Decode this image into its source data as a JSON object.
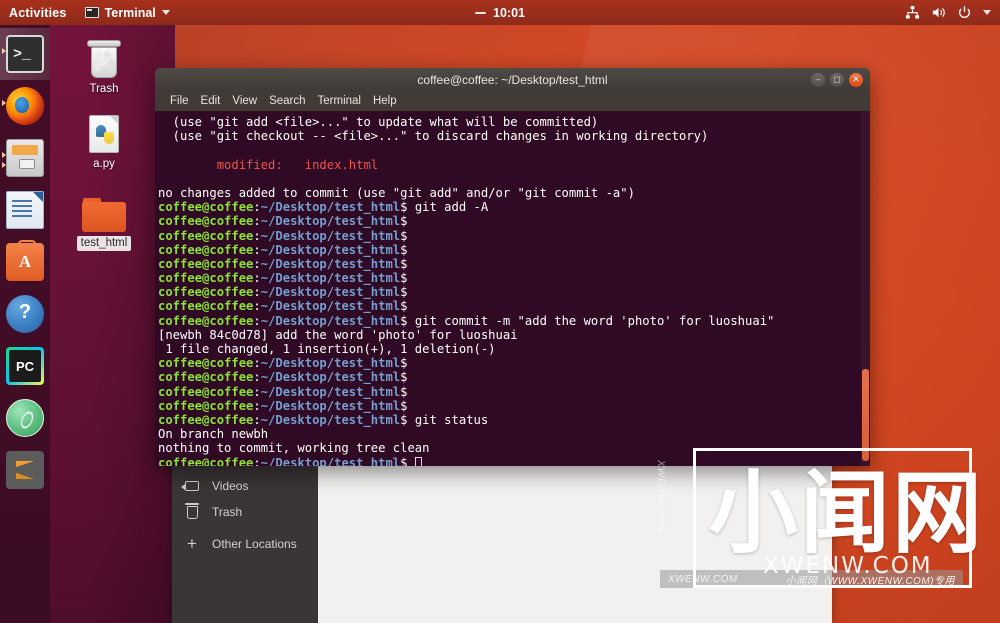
{
  "topbar": {
    "activities": "Activities",
    "app_name": "Terminal",
    "app_icon": "terminal-icon",
    "clock": "10:01",
    "indicators": [
      "network-icon",
      "volume-icon",
      "power-icon",
      "chevron-down-icon"
    ]
  },
  "launcher": {
    "items": [
      {
        "name": "terminal",
        "label": "Terminal",
        "active": true
      },
      {
        "name": "firefox",
        "label": "Firefox Web Browser",
        "active": false
      },
      {
        "name": "files",
        "label": "Files",
        "active": false
      },
      {
        "name": "libreoffice-writer",
        "label": "LibreOffice Writer",
        "active": false
      },
      {
        "name": "ubuntu-software",
        "label": "Ubuntu Software",
        "active": false
      },
      {
        "name": "help",
        "label": "Help",
        "active": false
      },
      {
        "name": "pycharm",
        "label": "PyCharm",
        "active": false
      },
      {
        "name": "atom",
        "label": "Atom",
        "active": false
      },
      {
        "name": "sublime-text",
        "label": "Sublime Text",
        "active": false
      }
    ]
  },
  "desktop": {
    "icons": [
      {
        "name": "trash",
        "label": "Trash",
        "selected": false
      },
      {
        "name": "a-py-file",
        "label": "a.py",
        "selected": false
      },
      {
        "name": "test-html-folder",
        "label": "test_html",
        "selected": true
      }
    ]
  },
  "file_manager": {
    "sidebar": [
      {
        "label": "Videos",
        "icon": "video-icon"
      },
      {
        "label": "Trash",
        "icon": "trash-icon"
      },
      {
        "label": "Other Locations",
        "icon": "plus-icon"
      }
    ]
  },
  "terminal": {
    "title": "coffee@coffee: ~/Desktop/test_html",
    "menu": [
      "File",
      "Edit",
      "View",
      "Search",
      "Terminal",
      "Help"
    ],
    "window_buttons": [
      "minimize",
      "maximize",
      "close"
    ],
    "prompt_user": "coffee@coffee",
    "prompt_path": "~/Desktop/test_html",
    "lines": [
      {
        "type": "plain",
        "text": "  (use \"git add <file>...\" to update what will be committed)"
      },
      {
        "type": "plain",
        "text": "  (use \"git checkout -- <file>...\" to discard changes in working directory)"
      },
      {
        "type": "plain",
        "text": ""
      },
      {
        "type": "red",
        "text": "        modified:   index.html"
      },
      {
        "type": "plain",
        "text": ""
      },
      {
        "type": "plain",
        "text": "no changes added to commit (use \"git add\" and/or \"git commit -a\")"
      },
      {
        "type": "prompt",
        "cmd": " git add -A"
      },
      {
        "type": "prompt",
        "cmd": ""
      },
      {
        "type": "prompt",
        "cmd": ""
      },
      {
        "type": "prompt",
        "cmd": ""
      },
      {
        "type": "prompt",
        "cmd": ""
      },
      {
        "type": "prompt",
        "cmd": ""
      },
      {
        "type": "prompt",
        "cmd": ""
      },
      {
        "type": "prompt",
        "cmd": ""
      },
      {
        "type": "prompt",
        "cmd": " git commit -m \"add the word 'photo' for luoshuai\""
      },
      {
        "type": "plain",
        "text": "[newbh 84c0d78] add the word 'photo' for luoshuai"
      },
      {
        "type": "plain",
        "text": " 1 file changed, 1 insertion(+), 1 deletion(-)"
      },
      {
        "type": "prompt",
        "cmd": ""
      },
      {
        "type": "prompt",
        "cmd": ""
      },
      {
        "type": "prompt",
        "cmd": ""
      },
      {
        "type": "prompt",
        "cmd": ""
      },
      {
        "type": "prompt",
        "cmd": " git status"
      },
      {
        "type": "plain",
        "text": "On branch newbh"
      },
      {
        "type": "plain",
        "text": "nothing to commit, working tree clean"
      },
      {
        "type": "prompt-cursor",
        "cmd": " "
      }
    ]
  },
  "watermark": {
    "logo": "小闻网",
    "domain": "XWENW.COM",
    "bar_left": "XWENW.COM",
    "bar_right": "小闻网（WWW.XWENW.COM)专用",
    "side": "XWENW.COM"
  },
  "colors": {
    "ubuntu_orange": "#dd4814",
    "terminal_bg": "#300a24",
    "prompt_green": "#8ae234",
    "prompt_blue": "#729fcf",
    "error_red": "#ef5350",
    "desktop_maroon": "#5e1033"
  }
}
